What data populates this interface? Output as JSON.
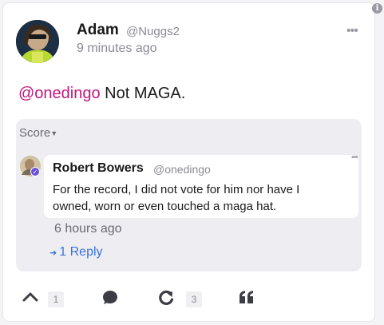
{
  "post": {
    "author_name": "Adam",
    "author_handle": "@Nuggs2",
    "timestamp": "9 minutes ago",
    "mention": "@onedingo",
    "body_text": " Not MAGA."
  },
  "icons": {
    "info": "info-icon",
    "menu": "more-dots-icon",
    "upvote": "chevron-up-icon",
    "comment": "comment-bubble-icon",
    "reshare": "reshare-arrow-icon",
    "quote": "quote-icon"
  },
  "replies": {
    "sort_label": "Score",
    "items": [
      {
        "author_name": "Robert Bowers",
        "author_handle": "@onedingo",
        "text": "For the record, I did not vote for him nor have I owned, worn or even touched a maga hat.",
        "timestamp": "6 hours ago",
        "reply_count_label": "1 Reply"
      }
    ]
  },
  "actions": {
    "upvote_count": "1",
    "reshare_count": "3"
  },
  "colors": {
    "mention": "#c2187a",
    "link": "#3a72d8",
    "verified": "#6b4fd8",
    "icon": "#3c3c44"
  }
}
